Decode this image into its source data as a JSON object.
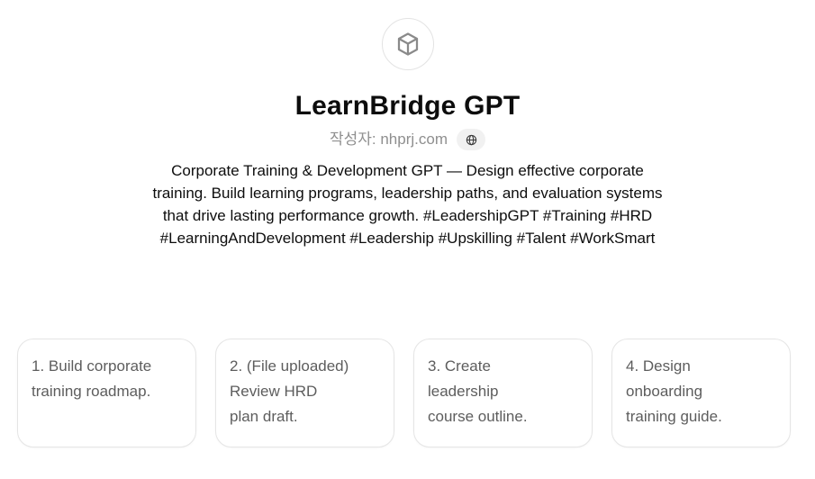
{
  "gpt": {
    "name": "LearnBridge GPT",
    "author_label": "작성자: nhprj.com",
    "avatar_icon": "cube-icon",
    "website_icon": "globe-icon",
    "description": "Corporate Training & Development GPT — Design effective corporate training. Build learning programs, leadership paths, and evaluation systems that drive lasting performance growth. #LeadershipGPT #Training #HRD #LearningAndDevelopment #Leadership #Upskilling #Talent #WorkSmart"
  },
  "starters": [
    {
      "lines": [
        "1. Build corporate",
        "training roadmap."
      ]
    },
    {
      "lines": [
        "2. (File uploaded)",
        "Review HRD",
        "plan draft."
      ]
    },
    {
      "lines": [
        "3. Create",
        "leadership",
        "course outline."
      ]
    },
    {
      "lines": [
        "4. Design",
        "onboarding",
        "training guide."
      ]
    }
  ]
}
